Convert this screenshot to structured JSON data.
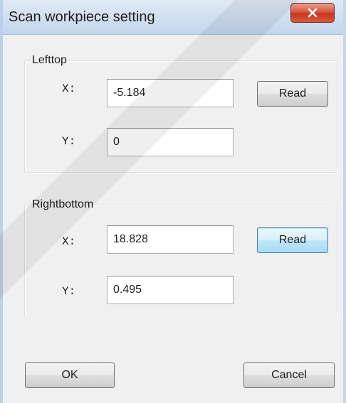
{
  "window": {
    "title": "Scan workpiece setting",
    "close_icon": "close-icon"
  },
  "lefttop": {
    "group_title": "Lefttop",
    "x_label": "X:",
    "x_value": "-5.184",
    "y_label": "Y:",
    "y_value": "0",
    "read_label": "Read"
  },
  "rightbottom": {
    "group_title": "Rightbottom",
    "x_label": "X:",
    "x_value": "18.828",
    "y_label": "Y:",
    "y_value": "0.495",
    "read_label": "Read"
  },
  "footer": {
    "ok_label": "OK",
    "cancel_label": "Cancel"
  },
  "colors": {
    "close_button": "#c8371d",
    "focused_button_border": "#3c7fb1",
    "titlebar": "#c3d6ec"
  }
}
